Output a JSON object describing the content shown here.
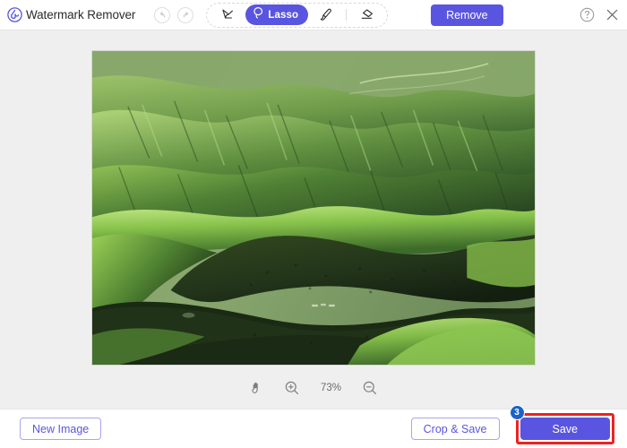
{
  "app": {
    "title": "Watermark Remover",
    "logo_icon": "waterdrop-logo-icon",
    "accent_color": "#5a55e0",
    "canvas_bg": "#efefef",
    "highlight_color": "#ee2222",
    "badge_color": "#1a63c8"
  },
  "header": {
    "history": [
      {
        "name": "undo-button",
        "icon": "undo-arrow-icon",
        "enabled": false
      },
      {
        "name": "redo-button",
        "icon": "redo-arrow-icon",
        "enabled": false
      }
    ],
    "tools": [
      {
        "name": "magic-wand-tool",
        "icon": "magic-wand-icon",
        "label": "",
        "active": false
      },
      {
        "name": "lasso-tool",
        "icon": "lasso-icon",
        "label": "Lasso",
        "active": true
      },
      {
        "name": "brush-tool",
        "icon": "brush-icon",
        "label": "",
        "active": false
      },
      {
        "name": "eraser-tool",
        "icon": "eraser-icon",
        "label": "",
        "active": false
      }
    ],
    "remove_label": "Remove",
    "help_icon": "question-circle-icon",
    "close_icon": "close-x-icon"
  },
  "canvas": {
    "image_alt": "green rolling hills landscape",
    "zoom": {
      "pan_icon": "hand-pan-icon",
      "zoom_in_icon": "zoom-in-icon",
      "level": "73%",
      "zoom_out_icon": "zoom-out-icon"
    }
  },
  "footer": {
    "new_image_label": "New Image",
    "crop_save_label": "Crop & Save",
    "save_label": "Save",
    "step_badge": "3"
  }
}
